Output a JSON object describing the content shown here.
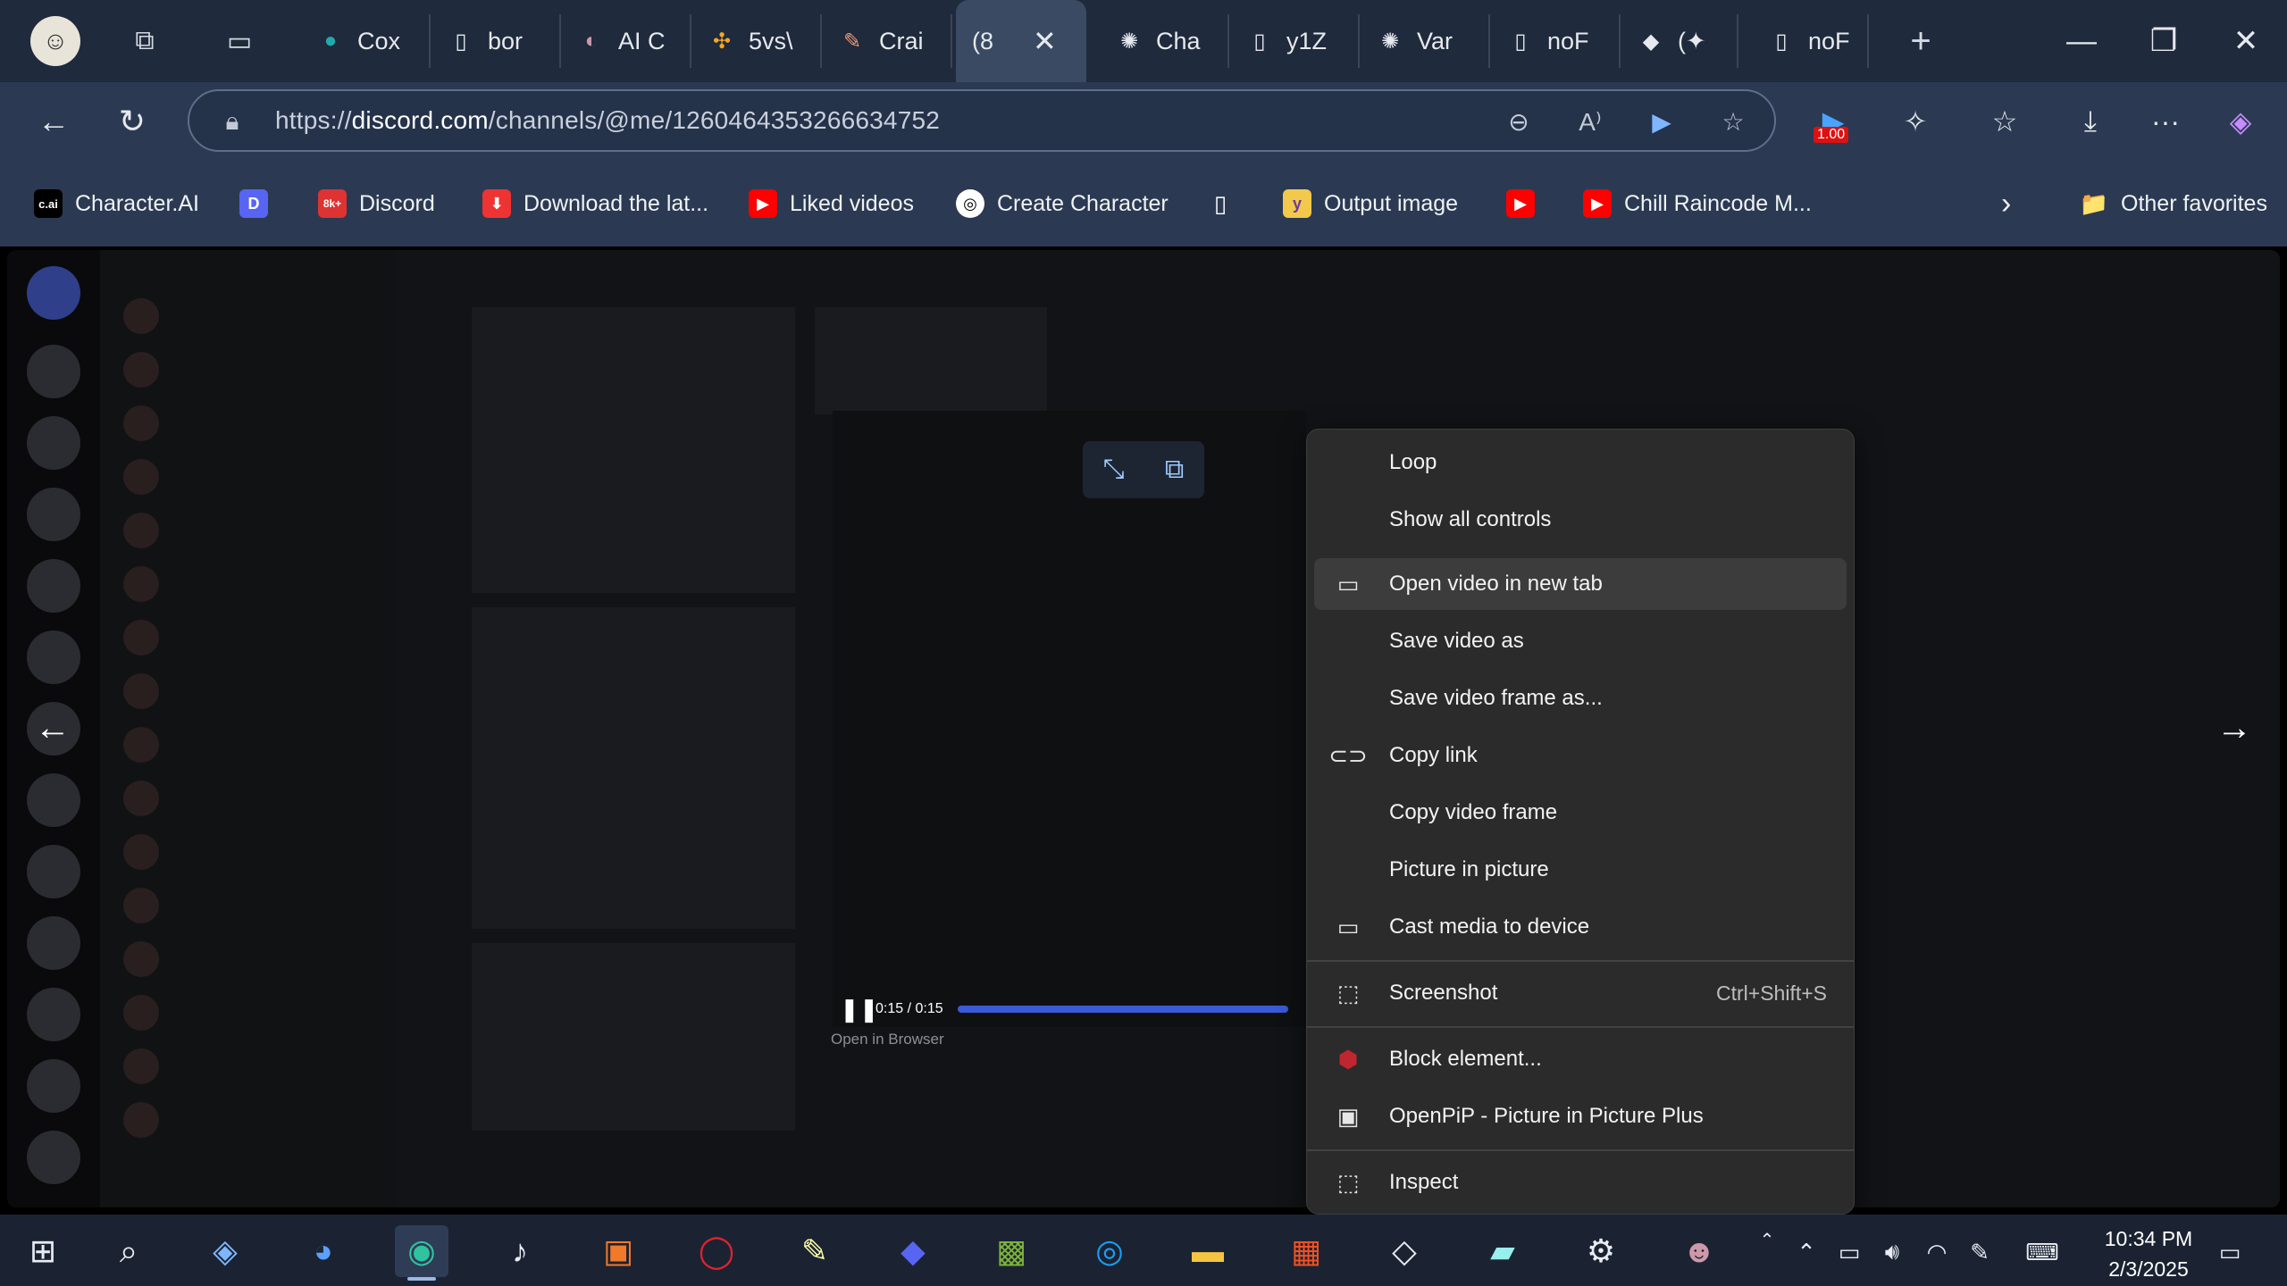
{
  "tabs": [
    {
      "label": "Cox",
      "icon": "circle-logo-icon"
    },
    {
      "label": "bor",
      "icon": "page-icon"
    },
    {
      "label": "AI C",
      "icon": "avatar-icon"
    },
    {
      "label": "5vs\\",
      "icon": "pinwheel-icon"
    },
    {
      "label": "Crai",
      "icon": "pen-icon"
    },
    {
      "label": "(8",
      "icon": "discord-icon",
      "active": true
    },
    {
      "label": "Cha",
      "icon": "openai-icon"
    },
    {
      "label": "y1Z",
      "icon": "page-icon"
    },
    {
      "label": "Var",
      "icon": "openai-icon"
    },
    {
      "label": "noF",
      "icon": "page-icon"
    },
    {
      "label": "(✦",
      "icon": "roblox-icon"
    },
    {
      "label": "noF",
      "icon": "page-icon"
    }
  ],
  "address": {
    "url_prefix": "https://",
    "url_domain": "discord.com",
    "url_path": "/channels/@me/1260464353266634752",
    "badge": "1.00"
  },
  "bookmarks": [
    {
      "label": "Character.AI",
      "icon_text": "c.ai"
    },
    {
      "label": "",
      "icon_text": "D"
    },
    {
      "label": "Discord",
      "icon_text": "8k+"
    },
    {
      "label": "Download the lat...",
      "icon_text": "⬇"
    },
    {
      "label": "Liked videos",
      "icon_text": "▶"
    },
    {
      "label": "Create Character",
      "icon_text": "◎"
    },
    {
      "label": "",
      "icon_text": "▯"
    },
    {
      "label": "Output image",
      "icon_text": "y"
    },
    {
      "label": "",
      "icon_text": "▶"
    },
    {
      "label": "Chill Raincode M...",
      "icon_text": "▶"
    },
    {
      "label": "Other favorites",
      "icon_text": "📁"
    }
  ],
  "player": {
    "time": "0:15 / 0:15",
    "progress": 1.0,
    "open_in_browser": "Open in Browser"
  },
  "context_menu": [
    {
      "label": "Loop",
      "icon": ""
    },
    {
      "label": "Show all controls",
      "icon": ""
    },
    {
      "label": "Open video in new tab",
      "icon": "new-tab-icon",
      "highlighted": true
    },
    {
      "label": "Save video as",
      "icon": ""
    },
    {
      "label": "Save video frame as...",
      "icon": ""
    },
    {
      "label": "Copy link",
      "icon": "link-icon"
    },
    {
      "label": "Copy video frame",
      "icon": ""
    },
    {
      "label": "Picture in picture",
      "icon": ""
    },
    {
      "label": "Cast media to device",
      "icon": "cast-icon"
    },
    {
      "label": "Screenshot",
      "icon": "screenshot-icon",
      "shortcut": "Ctrl+Shift+S"
    },
    {
      "label": "Block element...",
      "icon": "ublock-icon"
    },
    {
      "label": "OpenPiP - Picture in Picture Plus",
      "icon": "openpip-icon"
    },
    {
      "label": "Inspect",
      "icon": "inspect-icon"
    }
  ],
  "clock": {
    "time": "10:34 PM",
    "date": "2/3/2025"
  }
}
